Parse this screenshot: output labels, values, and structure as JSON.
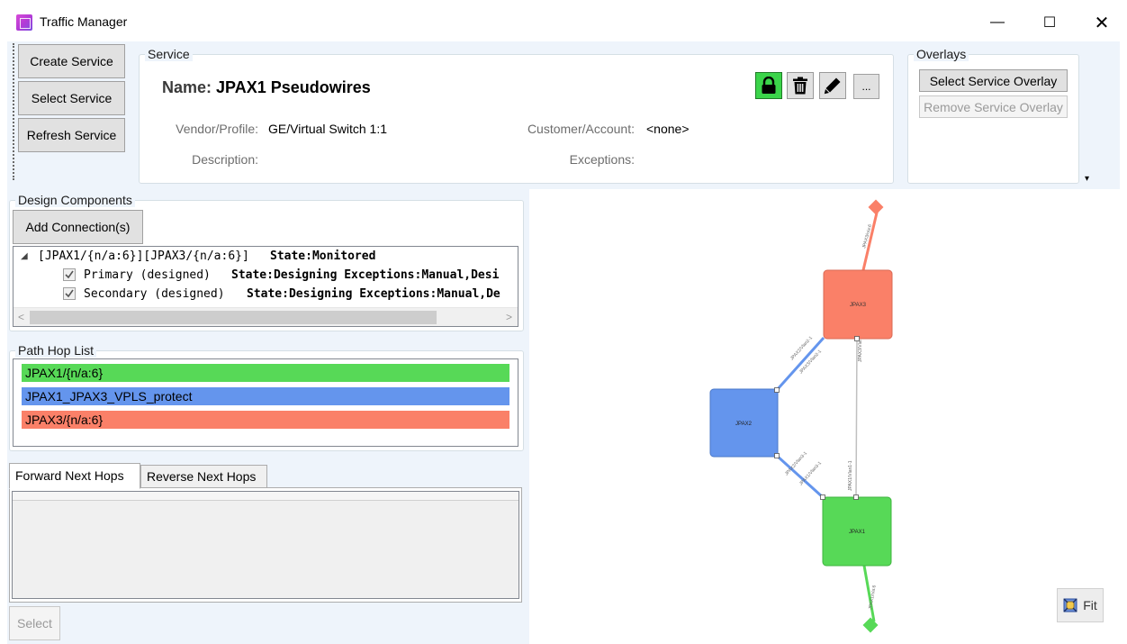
{
  "window": {
    "title": "Traffic Manager",
    "min_glyph": "—",
    "max_glyph": "☐",
    "close_glyph": "✕"
  },
  "toolbar": {
    "create_label": "Create Service",
    "select_label": "Select Service",
    "refresh_label": "Refresh Service"
  },
  "service": {
    "group_title": "Service",
    "name_label": "Name:",
    "name_value": "JPAX1 Pseudowires",
    "vendor_label": "Vendor/Profile:",
    "vendor_value": "GE/Virtual Switch 1:1",
    "customer_label": "Customer/Account:",
    "customer_value": "<none>",
    "description_label": "Description:",
    "exceptions_label": "Exceptions:",
    "more_label": "...",
    "icons": [
      "lock-icon",
      "trash-icon",
      "pencil-icon"
    ],
    "lock_color": "#3bd44a"
  },
  "overlays": {
    "group_title": "Overlays",
    "select_label": "Select Service Overlay",
    "remove_label": "Remove Service Overlay",
    "overflow_glyph": "▾"
  },
  "design": {
    "group_title": "Design Components",
    "add_label": "Add Connection(s)",
    "root_path": "[JPAX1/{n/a:6}][JPAX3/{n/a:6}]",
    "root_state": "State:Monitored",
    "children": [
      {
        "name": "Primary (designed)",
        "detail": "State:Designing Exceptions:Manual,Desi",
        "checked": true
      },
      {
        "name": "Secondary (designed)",
        "detail": "State:Designing Exceptions:Manual,De",
        "checked": true
      }
    ]
  },
  "hops": {
    "group_title": "Path Hop List",
    "items": [
      {
        "label": "JPAX1/{n/a:6}",
        "color": "#57d957"
      },
      {
        "label": "JPAX1_JPAX3_VPLS_protect",
        "color": "#6495ed"
      },
      {
        "label": "JPAX3/{n/a:6}",
        "color": "#fa8068"
      }
    ]
  },
  "tabs": {
    "forward": "Forward Next Hops",
    "reverse": "Reverse Next Hops"
  },
  "select_label": "Select",
  "topology": {
    "nodes": {
      "top": "JPAX3",
      "middle": "JPAX2",
      "bottom": "JPAX1"
    },
    "colors": {
      "red": "#fa8068",
      "blue": "#6495ed",
      "green": "#57d957",
      "gray": "#c0c0c0"
    },
    "link_labels": {
      "top_stub": "JPAX3/n/a:6",
      "jpax3_jpax2": "JPAX2/Vlan2-1",
      "jpax3_jpax2b": "JPAX3/Vlan2-1",
      "jpax3_jpax1": "JPAX3/Vlan1-1",
      "jpax2_jpax1": "JPAX2/Vlan3-1",
      "jpax2_jpax1b": "JPAX1/Vlan3-1",
      "jpax1_jpax3": "JPAX1/Vlan1-1",
      "bottom_stub": "JPAX1/n/a:6"
    },
    "fit_label": "Fit"
  }
}
